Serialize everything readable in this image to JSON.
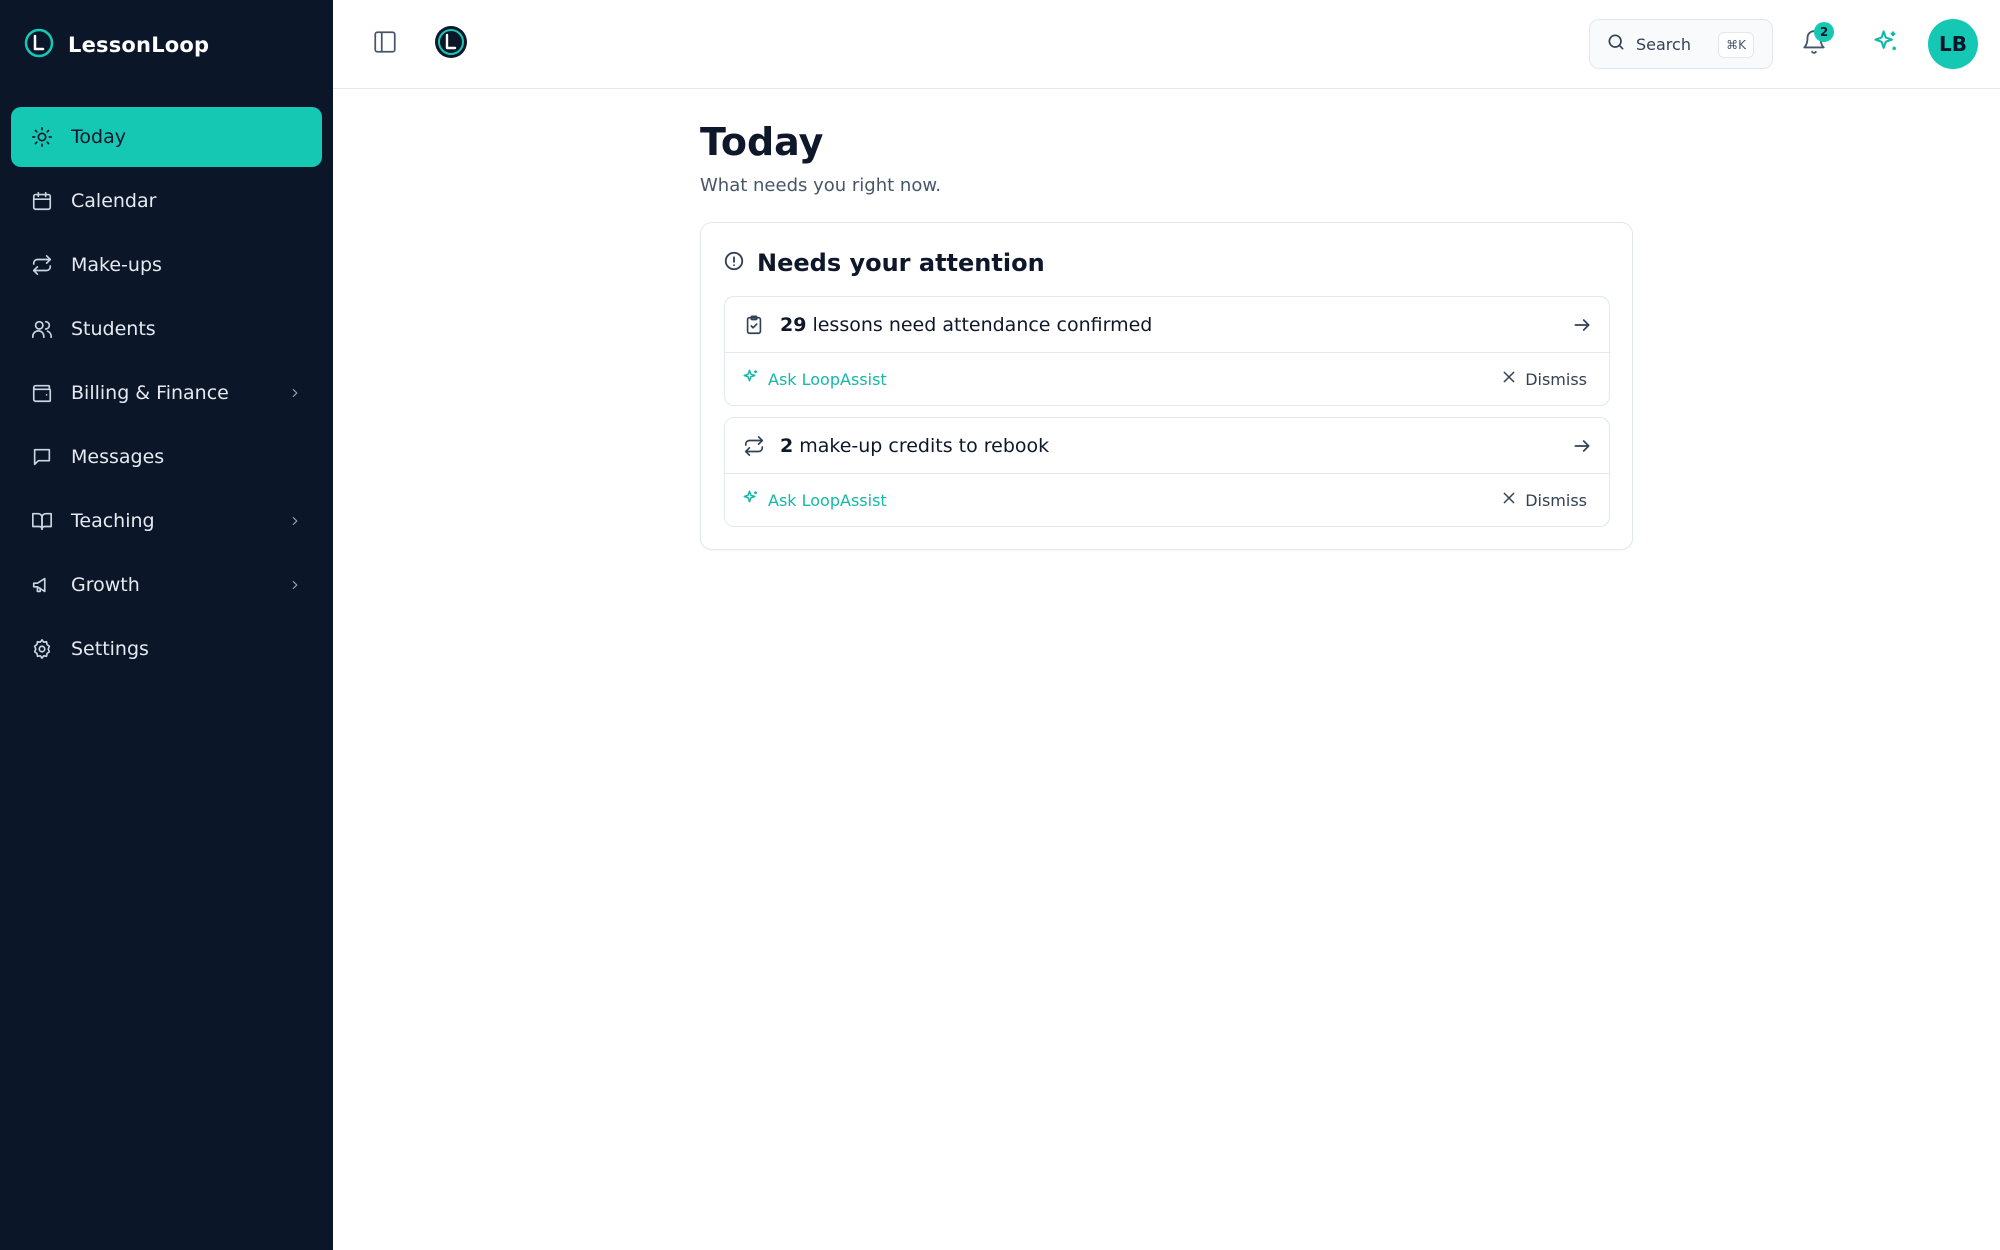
{
  "brand": {
    "name": "LessonLoop"
  },
  "colors": {
    "accent": "#14c8b4",
    "sidebar_bg": "#0b1629",
    "text": "#0f172a"
  },
  "sidebar": {
    "items": [
      {
        "label": "Today",
        "icon": "sun-icon",
        "active": true,
        "expandable": false
      },
      {
        "label": "Calendar",
        "icon": "calendar-icon",
        "active": false,
        "expandable": false
      },
      {
        "label": "Make-ups",
        "icon": "repeat-icon",
        "active": false,
        "expandable": false
      },
      {
        "label": "Students",
        "icon": "users-icon",
        "active": false,
        "expandable": false
      },
      {
        "label": "Billing & Finance",
        "icon": "wallet-icon",
        "active": false,
        "expandable": true
      },
      {
        "label": "Messages",
        "icon": "message-icon",
        "active": false,
        "expandable": false
      },
      {
        "label": "Teaching",
        "icon": "book-icon",
        "active": false,
        "expandable": true
      },
      {
        "label": "Growth",
        "icon": "megaphone-icon",
        "active": false,
        "expandable": true
      },
      {
        "label": "Settings",
        "icon": "gear-icon",
        "active": false,
        "expandable": false
      }
    ]
  },
  "topbar": {
    "search_label": "Search",
    "search_shortcut": "⌘K",
    "notification_count": "2",
    "avatar_initials": "LB"
  },
  "main": {
    "title": "Today",
    "subtitle": "What needs you right now.",
    "attention": {
      "title": "Needs your attention",
      "cards": [
        {
          "icon": "clipboard-check-icon",
          "count": "29",
          "text": "lessons need attendance confirmed",
          "ask_label": "Ask LoopAssist",
          "dismiss_label": "Dismiss"
        },
        {
          "icon": "repeat-icon",
          "count": "2",
          "text": "make-up credits to rebook",
          "ask_label": "Ask LoopAssist",
          "dismiss_label": "Dismiss"
        }
      ]
    }
  }
}
